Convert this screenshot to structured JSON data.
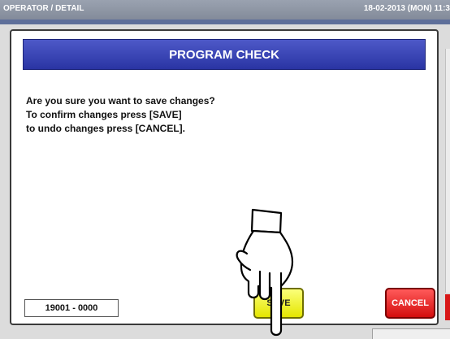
{
  "topbar": {
    "title": "OPERATOR / DETAIL",
    "datetime": "18-02-2013 (MON) 11:3"
  },
  "dialog": {
    "title": "PROGRAM CHECK",
    "message_lines": [
      "Are you sure you want to save changes?",
      "To confirm changes press [SAVE]",
      "to undo changes press [CANCEL]."
    ],
    "code": "19001 - 0000",
    "save_label": "SAVE",
    "cancel_label": "CANCEL"
  },
  "colors": {
    "header_blue": "#2a34a3",
    "save_yellow": "#e5e600",
    "cancel_red": "#d40d0d"
  },
  "icons": {
    "pointer": "pointing-hand-icon"
  }
}
